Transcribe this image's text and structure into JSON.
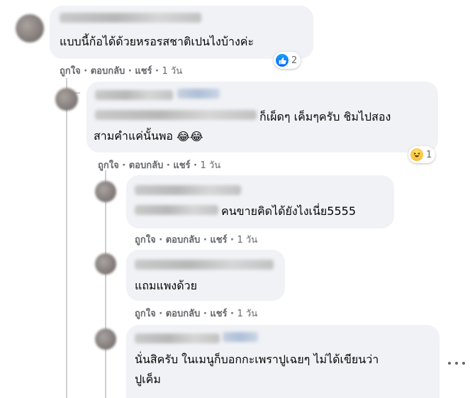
{
  "comments": [
    {
      "id": "c1",
      "text_lines": [
        "แบบนี้ก้อได้ด้วยหรอรสชาติเปนไงบ้างค่ะ"
      ],
      "actions": {
        "like": "ถูกใจ",
        "reply": "ตอบกลับ",
        "share": "แชร์",
        "time": "1 วัน"
      },
      "reaction": {
        "icon": "like-icon",
        "count": "2",
        "color": "#0866ff"
      }
    },
    {
      "id": "c2",
      "text_lines": [
        "ก็เผ็ดๆ เค็มๆครับ ชิมไปสอง",
        "สามคำแค่นั้นพอ"
      ],
      "emoji": [
        "😂",
        "😂"
      ],
      "actions": {
        "like": "ถูกใจ",
        "reply": "ตอบกลับ",
        "share": "แชร์",
        "time": "1 วัน"
      },
      "reaction": {
        "icon": "haha-icon",
        "count": "1",
        "color": "#f7b125"
      }
    },
    {
      "id": "c3",
      "text_lines": [
        "คนขายคิดได้ยังไงเนี่ย5555"
      ],
      "actions": {
        "like": "ถูกใจ",
        "reply": "ตอบกลับ",
        "share": "แชร์",
        "time": "1 วัน"
      }
    },
    {
      "id": "c4",
      "text_lines": [
        "แถมแพงด้วย"
      ],
      "actions": {
        "like": "ถูกใจ",
        "reply": "ตอบกลับ",
        "share": "แชร์",
        "time": "1 วัน"
      }
    },
    {
      "id": "c5",
      "text_lines": [
        "นั่นสิครับ ในเมนูก็บอกกะเพราปูเฉยๆ ไม่ได้เขียนว่า",
        "ปูเค็ม"
      ]
    }
  ],
  "separator": "·",
  "colors": {
    "bubble": "#f0f2f5",
    "meta": "#65676b",
    "text": "#050505"
  }
}
